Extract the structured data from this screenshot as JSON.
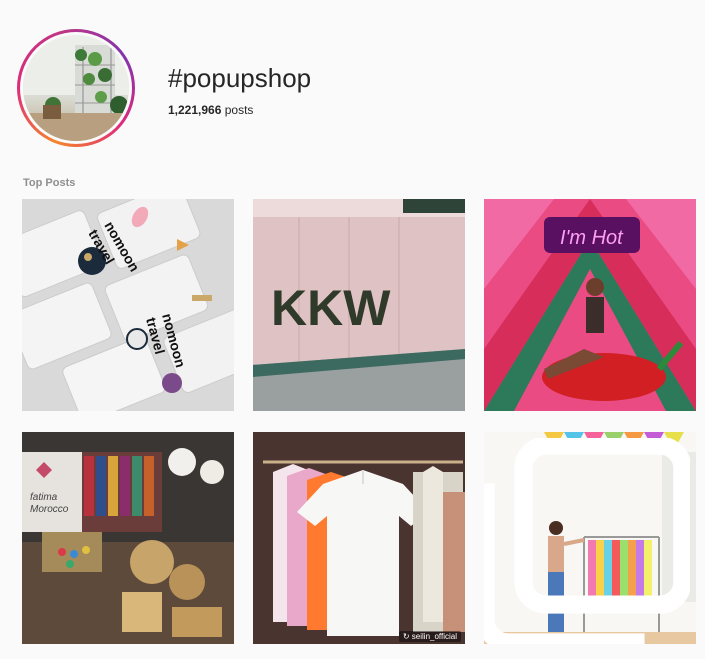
{
  "header": {
    "hashtag": "#popupshop",
    "post_count_number": "1,221,966",
    "post_count_suffix": " posts"
  },
  "section": {
    "label": "Top Posts"
  },
  "posts": [
    {
      "name": "post-pins-nomoon-travel",
      "overlay": {
        "lines": [
          "nomoon",
          "travel"
        ]
      }
    },
    {
      "name": "post-kkw-storefront",
      "overlay": {
        "text": "KKW"
      }
    },
    {
      "name": "post-im-hot-pepper",
      "overlay": {
        "text": "I'm Hot"
      }
    },
    {
      "name": "post-fatima-morocco-shop",
      "overlay": {
        "lines": [
          "fatima",
          "Morocco"
        ]
      }
    },
    {
      "name": "post-tshirts-rack",
      "overlay": {
        "credit": "seilin_official"
      }
    },
    {
      "name": "post-colorful-garments",
      "overlay": {
        "multi_icon": "multiple-images-icon"
      }
    }
  ],
  "colors": {
    "ring_start": "#f58529",
    "ring_mid": "#dd2a7b",
    "ring_end": "#8134af"
  }
}
